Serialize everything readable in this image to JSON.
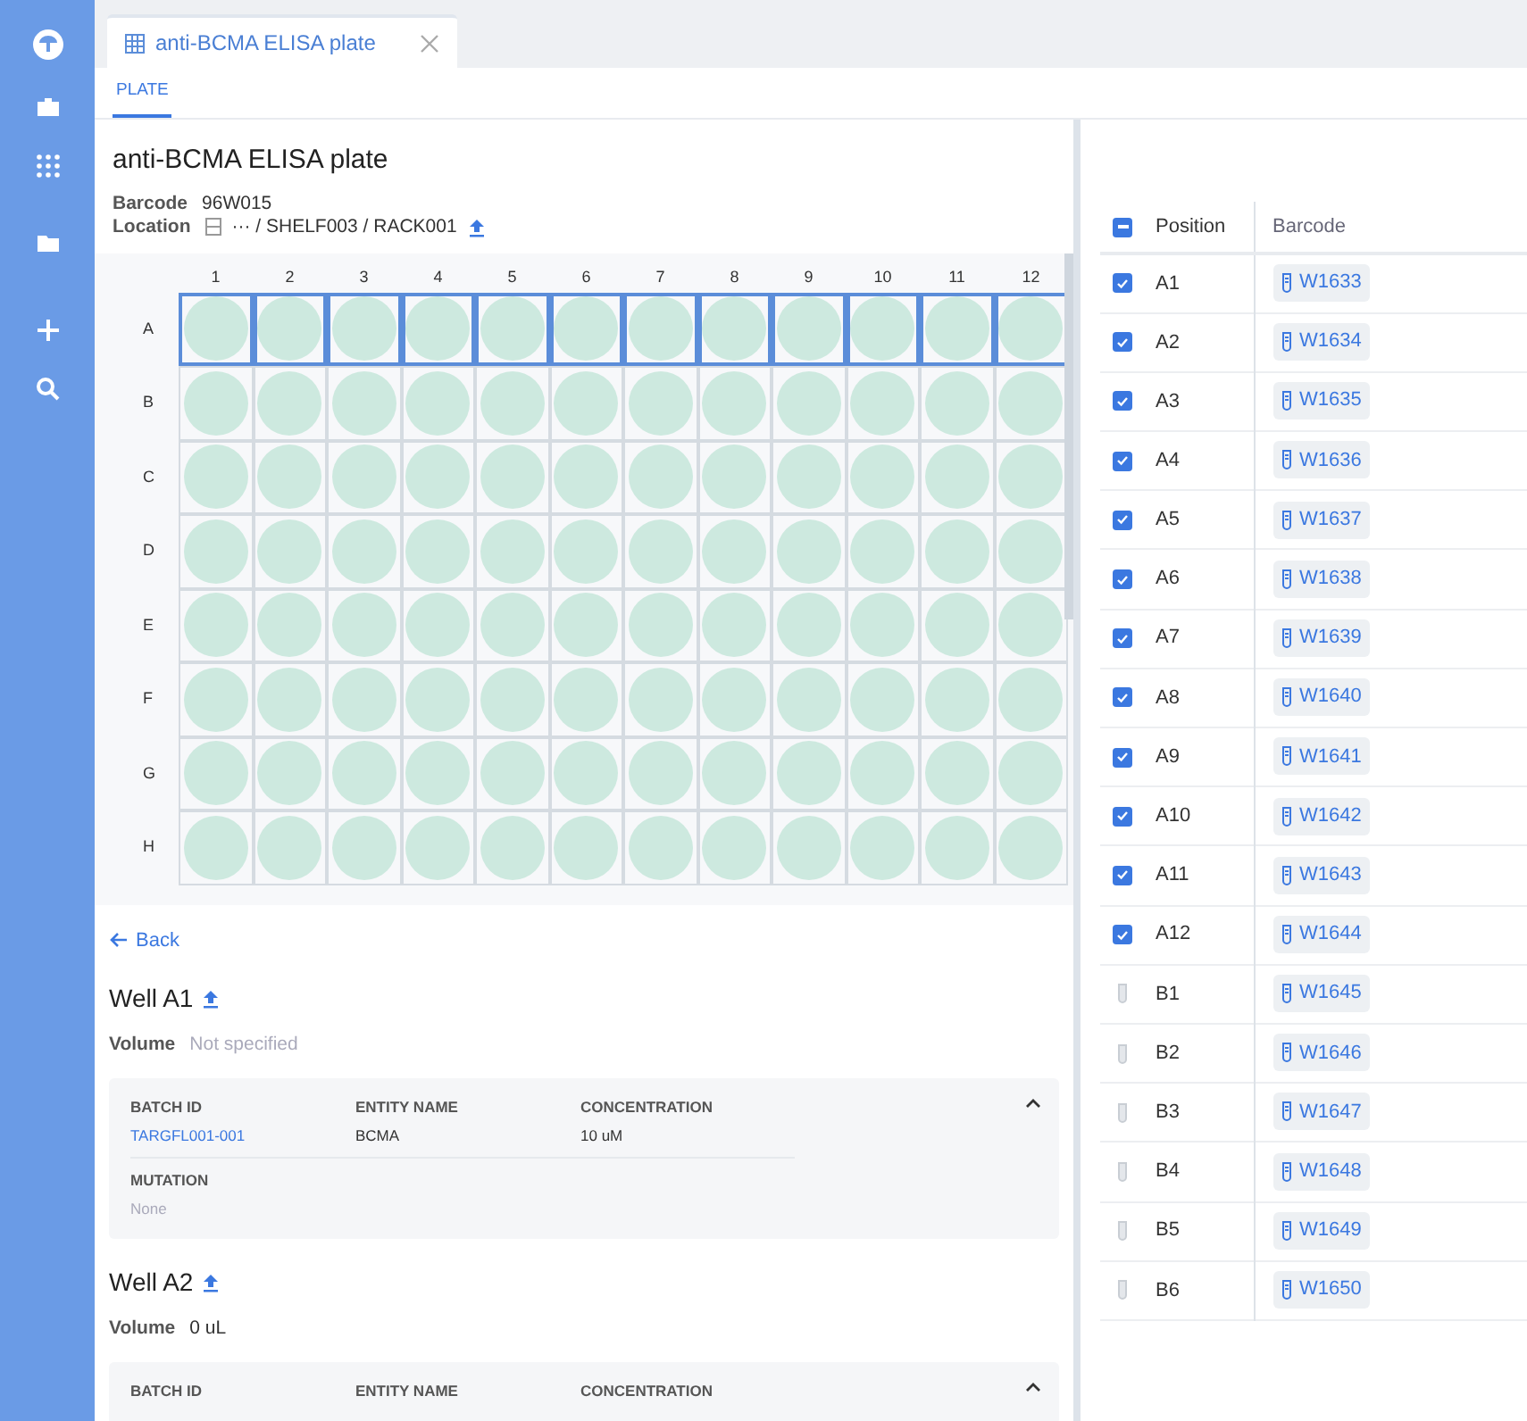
{
  "tab": {
    "title": "anti-BCMA ELISA plate"
  },
  "subtabs": [
    {
      "label": "PLATE",
      "selected": true
    }
  ],
  "plate_info": {
    "title": "anti-BCMA ELISA plate",
    "barcode_label": "Barcode",
    "barcode": "96W015",
    "location_label": "Location",
    "location": "··· / SHELF003 / RACK001"
  },
  "plate": {
    "columns": [
      "1",
      "2",
      "3",
      "4",
      "5",
      "6",
      "7",
      "8",
      "9",
      "10",
      "11",
      "12"
    ],
    "rows": [
      {
        "label": "A",
        "wells": [
          {
            "selected": true
          },
          {
            "selected": true
          },
          {
            "selected": true
          },
          {
            "selected": true
          },
          {
            "selected": true
          },
          {
            "selected": true
          },
          {
            "selected": true
          },
          {
            "selected": true
          },
          {
            "selected": true
          },
          {
            "selected": true
          },
          {
            "selected": true
          },
          {
            "selected": true
          }
        ]
      },
      {
        "label": "B",
        "wells": [
          {
            "selected": false
          },
          {
            "selected": false
          },
          {
            "selected": false
          },
          {
            "selected": false
          },
          {
            "selected": false
          },
          {
            "selected": false
          },
          {
            "selected": false
          },
          {
            "selected": false
          },
          {
            "selected": false
          },
          {
            "selected": false
          },
          {
            "selected": false
          },
          {
            "selected": false
          }
        ]
      },
      {
        "label": "C",
        "wells": [
          {
            "selected": false
          },
          {
            "selected": false
          },
          {
            "selected": false
          },
          {
            "selected": false
          },
          {
            "selected": false
          },
          {
            "selected": false
          },
          {
            "selected": false
          },
          {
            "selected": false
          },
          {
            "selected": false
          },
          {
            "selected": false
          },
          {
            "selected": false
          },
          {
            "selected": false
          }
        ]
      },
      {
        "label": "D",
        "wells": [
          {
            "selected": false
          },
          {
            "selected": false
          },
          {
            "selected": false
          },
          {
            "selected": false
          },
          {
            "selected": false
          },
          {
            "selected": false
          },
          {
            "selected": false
          },
          {
            "selected": false
          },
          {
            "selected": false
          },
          {
            "selected": false
          },
          {
            "selected": false
          },
          {
            "selected": false
          }
        ]
      },
      {
        "label": "E",
        "wells": [
          {
            "selected": false
          },
          {
            "selected": false
          },
          {
            "selected": false
          },
          {
            "selected": false
          },
          {
            "selected": false
          },
          {
            "selected": false
          },
          {
            "selected": false
          },
          {
            "selected": false
          },
          {
            "selected": false
          },
          {
            "selected": false
          },
          {
            "selected": false
          },
          {
            "selected": false
          }
        ]
      },
      {
        "label": "F",
        "wells": [
          {
            "selected": false
          },
          {
            "selected": false
          },
          {
            "selected": false
          },
          {
            "selected": false
          },
          {
            "selected": false
          },
          {
            "selected": false
          },
          {
            "selected": false
          },
          {
            "selected": false
          },
          {
            "selected": false
          },
          {
            "selected": false
          },
          {
            "selected": false
          },
          {
            "selected": false
          }
        ]
      },
      {
        "label": "G",
        "wells": [
          {
            "selected": false
          },
          {
            "selected": false
          },
          {
            "selected": false
          },
          {
            "selected": false
          },
          {
            "selected": false
          },
          {
            "selected": false
          },
          {
            "selected": false
          },
          {
            "selected": false
          },
          {
            "selected": false
          },
          {
            "selected": false
          },
          {
            "selected": false
          },
          {
            "selected": false
          }
        ]
      },
      {
        "label": "H",
        "wells": [
          {
            "selected": false
          },
          {
            "selected": false
          },
          {
            "selected": false
          },
          {
            "selected": false
          },
          {
            "selected": false
          },
          {
            "selected": false
          },
          {
            "selected": false
          },
          {
            "selected": false
          },
          {
            "selected": false
          },
          {
            "selected": false
          },
          {
            "selected": false
          },
          {
            "selected": false
          }
        ]
      }
    ]
  },
  "back": "Back",
  "wells_detail": [
    {
      "title": "Well A1",
      "volume_label": "Volume",
      "volume": "Not specified",
      "volume_empty": true,
      "expanded": true,
      "fields": [
        {
          "label": "BATCH ID",
          "value": "TARGFL001-001",
          "kind": "link"
        },
        {
          "label": "ENTITY NAME",
          "value": "BCMA",
          "kind": "text"
        },
        {
          "label": "CONCENTRATION",
          "value": "10 uM",
          "kind": "text"
        },
        {
          "label": "MUTATION",
          "value": "None",
          "kind": "empty"
        }
      ]
    },
    {
      "title": "Well A2",
      "volume_label": "Volume",
      "volume": "0 uL",
      "volume_empty": false,
      "expanded": true,
      "fields": [
        {
          "label": "BATCH ID",
          "kind": "link"
        },
        {
          "label": "ENTITY NAME",
          "kind": "text"
        },
        {
          "label": "CONCENTRATION",
          "kind": "text"
        }
      ]
    }
  ],
  "table": {
    "select_all_checked": true,
    "select_all_partial": true,
    "columns": [
      "Position",
      "Barcode"
    ],
    "rows": [
      {
        "position": "A1",
        "barcode": "W1633",
        "checked": true
      },
      {
        "position": "A2",
        "barcode": "W1634",
        "checked": true
      },
      {
        "position": "A3",
        "barcode": "W1635",
        "checked": true
      },
      {
        "position": "A4",
        "barcode": "W1636",
        "checked": true
      },
      {
        "position": "A5",
        "barcode": "W1637",
        "checked": true
      },
      {
        "position": "A6",
        "barcode": "W1638",
        "checked": true
      },
      {
        "position": "A7",
        "barcode": "W1639",
        "checked": true
      },
      {
        "position": "A8",
        "barcode": "W1640",
        "checked": true
      },
      {
        "position": "A9",
        "barcode": "W1641",
        "checked": true
      },
      {
        "position": "A10",
        "barcode": "W1642",
        "checked": true
      },
      {
        "position": "A11",
        "barcode": "W1643",
        "checked": true
      },
      {
        "position": "A12",
        "barcode": "W1644",
        "checked": true
      },
      {
        "position": "B1",
        "barcode": "W1645",
        "checked": false
      },
      {
        "position": "B2",
        "barcode": "W1646",
        "checked": false
      },
      {
        "position": "B3",
        "barcode": "W1647",
        "checked": false
      },
      {
        "position": "B4",
        "barcode": "W1648",
        "checked": false
      },
      {
        "position": "B5",
        "barcode": "W1649",
        "checked": false
      },
      {
        "position": "B6",
        "barcode": "W1650",
        "checked": false
      }
    ]
  }
}
